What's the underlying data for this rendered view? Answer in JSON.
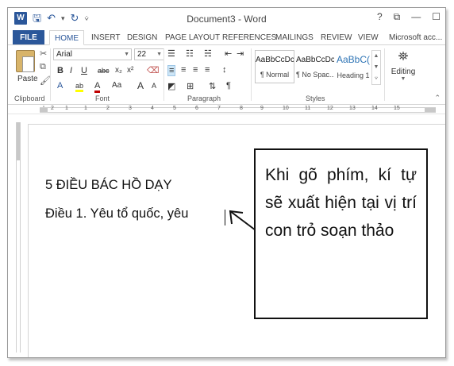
{
  "window": {
    "title": "Document3 - Word",
    "controls": [
      "?",
      "⧉",
      "—",
      "☐"
    ]
  },
  "qat": {
    "app_icon": "W",
    "save_icon": "save-icon",
    "undo_icon": "undo-icon",
    "redo_icon": "redo-icon",
    "more": "⩒"
  },
  "tabs": [
    {
      "label": "FILE"
    },
    {
      "label": "HOME"
    },
    {
      "label": "INSERT"
    },
    {
      "label": "DESIGN"
    },
    {
      "label": "PAGE LAYOUT"
    },
    {
      "label": "REFERENCES"
    },
    {
      "label": "MAILINGS"
    },
    {
      "label": "REVIEW"
    },
    {
      "label": "VIEW"
    },
    {
      "label": "Microsoft acc..."
    }
  ],
  "ribbon": {
    "clipboard": {
      "paste_label": "Paste",
      "group_label": "Clipboard"
    },
    "font": {
      "font_name": "Arial",
      "font_size": "22",
      "bold": "B",
      "italic": "I",
      "underline": "U",
      "strike": "abc",
      "subscript": "x₂",
      "superscript": "x²",
      "text_effects": "A",
      "highlight": "ab",
      "font_color": "A",
      "change_case": "Aa",
      "grow": "A",
      "shrink": "A",
      "group_label": "Font"
    },
    "paragraph": {
      "group_label": "Paragraph",
      "pilcrow": "¶"
    },
    "styles": {
      "items": [
        {
          "preview": "AaBbCcDc",
          "name": "¶ Normal"
        },
        {
          "preview": "AaBbCcDc",
          "name": "¶ No Spac..."
        },
        {
          "preview": "AaBbC(",
          "name": "Heading 1"
        }
      ],
      "group_label": "Styles"
    },
    "editing": {
      "label": "Editing"
    }
  },
  "ruler": {
    "numbers": [
      "2",
      "1",
      "1",
      "2",
      "3",
      "4",
      "5",
      "6",
      "7",
      "8",
      "9",
      "10",
      "11",
      "12",
      "13",
      "14",
      "15"
    ]
  },
  "document": {
    "line1": "5 ĐIỀU BÁC HỒ DẠY",
    "line2": "Điều 1. Yêu tổ quốc, yêu"
  },
  "callout": {
    "text": "Khi gõ phím, kí tự sẽ xuất hiện tại vị trí con trỏ soạn thảo"
  },
  "colors": {
    "accent": "#2b579a",
    "heading_style": "#2e74b5"
  }
}
